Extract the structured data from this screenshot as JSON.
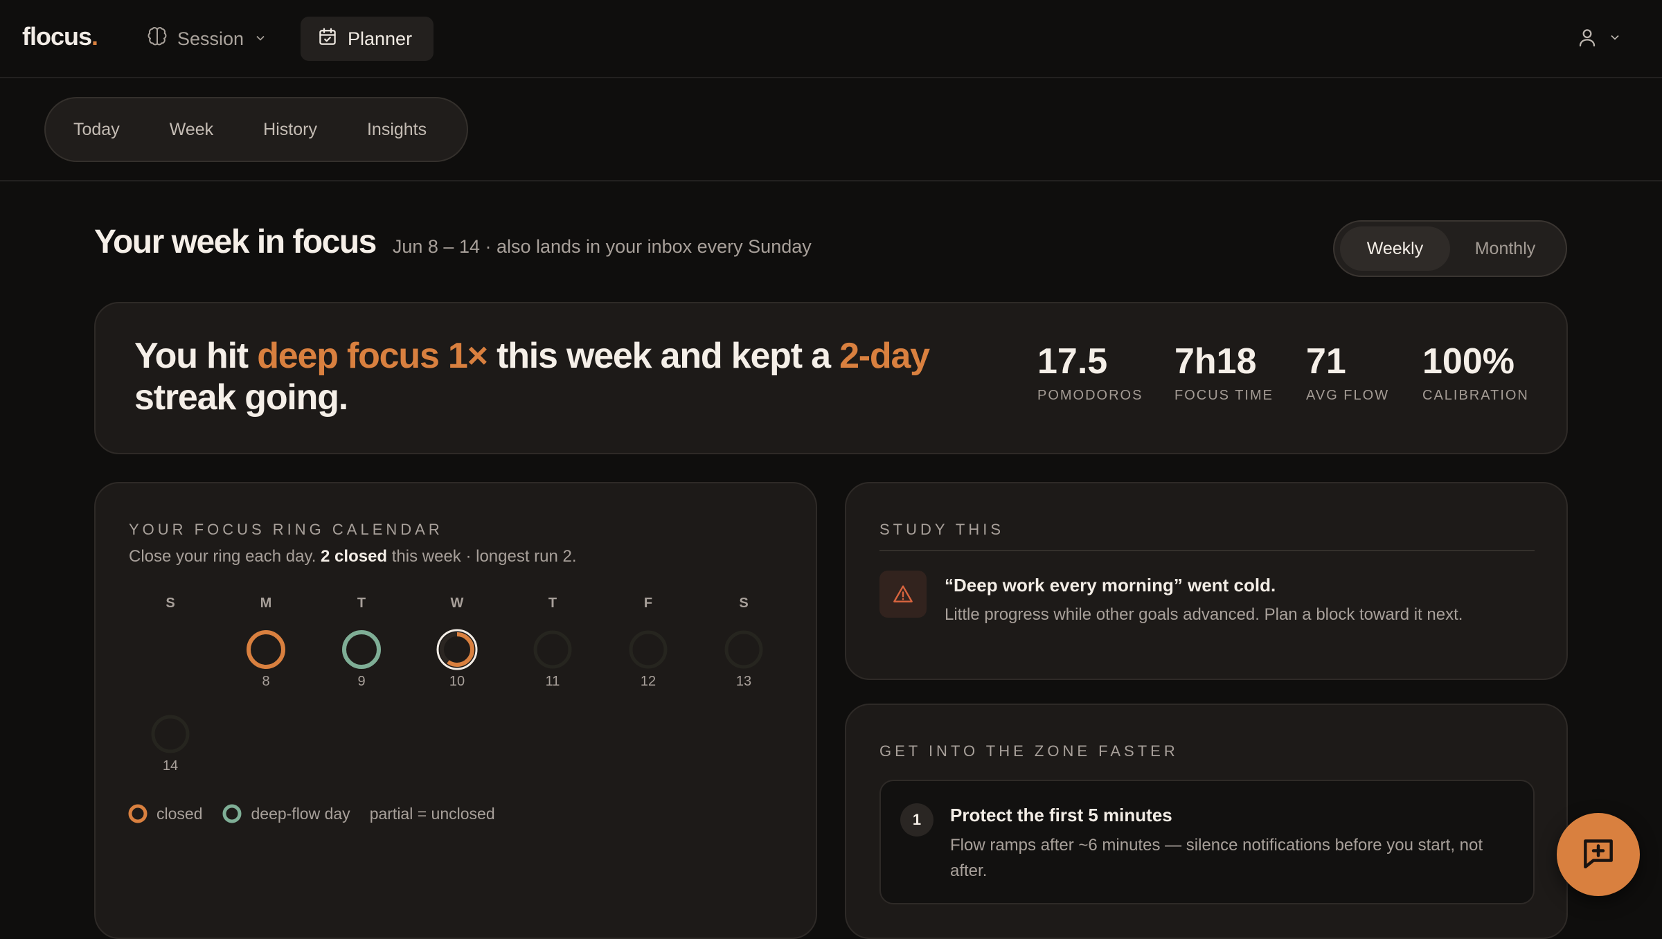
{
  "app": {
    "logo_text": "flocus",
    "logo_dot": "."
  },
  "topnav": {
    "session_label": "Session",
    "session_icon": "brain-icon",
    "planner_label": "Planner",
    "planner_icon": "calendar-check-icon",
    "user_icon": "user-icon"
  },
  "subnav": {
    "tabs": [
      {
        "label": "Today"
      },
      {
        "label": "Week"
      },
      {
        "label": "History"
      },
      {
        "label": "Insights"
      }
    ]
  },
  "header": {
    "title": "Your week in focus",
    "subtitle": "Jun 8 – 14 · also lands in your inbox every Sunday",
    "period_options": [
      "Weekly",
      "Monthly"
    ],
    "period_selected": "Weekly"
  },
  "summary": {
    "headline_1": "You hit ",
    "headline_accent_1": "deep focus 1×",
    "headline_2": " this week and kept a ",
    "headline_accent_2": "2-day",
    "headline_3": " streak going.",
    "stats": [
      {
        "value": "17.5",
        "label": "POMODOROS"
      },
      {
        "value": "7h18",
        "label": "FOCUS TIME"
      },
      {
        "value": "71",
        "label": "AVG FLOW"
      },
      {
        "value": "100%",
        "label": "CALIBRATION"
      }
    ]
  },
  "ring_calendar": {
    "title": "YOUR FOCUS RING CALENDAR",
    "desc_1": "Close your ring each day. ",
    "desc_bold": "2 closed",
    "desc_2": " this week · longest run 2.",
    "weekdays": [
      "S",
      "M",
      "T",
      "W",
      "T",
      "F",
      "S"
    ],
    "days": [
      {
        "num": "8",
        "state": "closed",
        "progress": 1.0
      },
      {
        "num": "9",
        "state": "deep-flow",
        "progress": 1.0
      },
      {
        "num": "10",
        "state": "today-partial",
        "progress": 0.6
      },
      {
        "num": "11",
        "state": "empty",
        "progress": 0
      },
      {
        "num": "12",
        "state": "empty",
        "progress": 0
      },
      {
        "num": "13",
        "state": "empty",
        "progress": 0
      },
      {
        "num": "14",
        "state": "empty",
        "progress": 0
      }
    ],
    "legend": {
      "closed": "closed",
      "deep_flow": "deep-flow day",
      "partial": "partial = unclosed"
    }
  },
  "study": {
    "title": "STUDY THIS",
    "item_title": "“Deep work every morning” went cold.",
    "item_body": "Little progress while other goals advanced. Plan a block toward it next.",
    "icon": "warning-icon"
  },
  "zone": {
    "title": "GET INTO THE ZONE FASTER",
    "tips": [
      {
        "num": "1",
        "title": "Protect the first 5 minutes",
        "body": "Flow ramps after ~6 minutes — silence notifications before you start, not after."
      }
    ]
  },
  "fab": {
    "icon": "chat-plus-icon"
  },
  "colors": {
    "accent": "#d9803f",
    "deep_flow": "#7fae96",
    "background": "#0f0e0d",
    "card": "#1d1a18"
  }
}
